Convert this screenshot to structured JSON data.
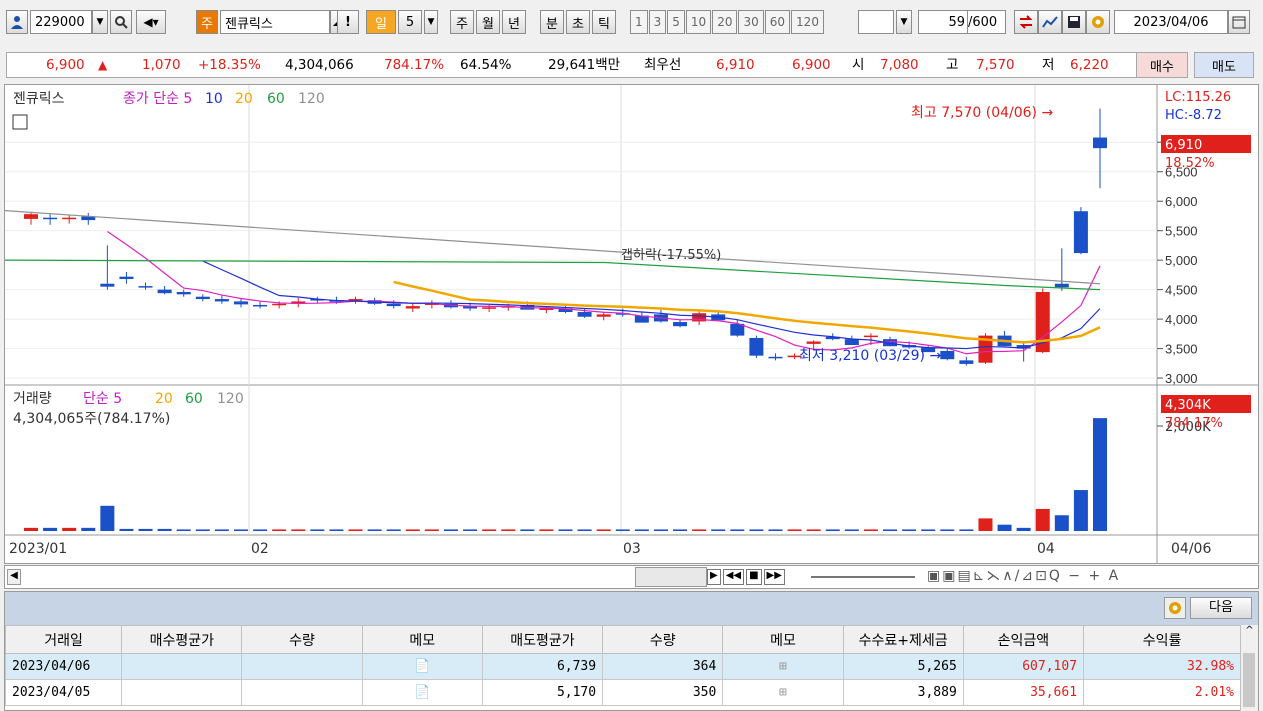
{
  "toolbar": {
    "code": "229000",
    "market": "주",
    "name": "젠큐릭스",
    "excl": "!",
    "period": "일",
    "num": "5",
    "btn_week": "주",
    "btn_month": "월",
    "btn_year": "년",
    "btn_minute": "분",
    "btn_second": "초",
    "btn_tick": "틱",
    "intervals": [
      "1",
      "3",
      "5",
      "10",
      "20",
      "30",
      "60",
      "120"
    ],
    "count": "59",
    "count_total": "/600",
    "date": "2023/04/06"
  },
  "price_bar": {
    "price": "6,900",
    "arrow": "▲",
    "change": "1,070",
    "pct": "+18.35%",
    "volume": "4,304,066",
    "vol_ratio": "784.17%",
    "turnover": "64.54%",
    "amount": "29,641백만",
    "best_label": "최우선",
    "best_sell": "6,910",
    "best_buy": "6,900",
    "open_label": "시",
    "open": "7,080",
    "high_label": "고",
    "high": "7,570",
    "low_label": "저",
    "low": "6,220",
    "buy_btn": "매수",
    "sell_btn": "매도"
  },
  "chart": {
    "legend": {
      "name": "젠큐릭스",
      "close_label": "종가 단순",
      "ma": [
        "5",
        "10",
        "20",
        "60",
        "120"
      ]
    },
    "vol_legend": {
      "name": "거래량",
      "simple": "단순",
      "ma": [
        "5",
        "20",
        "60",
        "120"
      ],
      "value": "4,304,065주(784.17%)"
    },
    "y_ticks": [
      "7,000",
      "6,500",
      "6,000",
      "5,500",
      "5,000",
      "4,500",
      "4,000",
      "3,500",
      "3,000"
    ],
    "vol_tick": "2,000K",
    "right_price": "6,910",
    "right_pct": "18.52%",
    "lc": "LC:115.26",
    "hc": "HC:-8.72",
    "vol_right": "4,304K",
    "vol_right_pct": "784.17%",
    "x_labels": [
      "2023/01",
      "02",
      "03",
      "04"
    ],
    "x_right": "04/06",
    "high_note": "최고 7,570 (04/06)",
    "low_note": "최저 3,210 (03/29)",
    "gap_note": "갭하락(-17.55%)",
    "colors": {
      "up": "#e0201b",
      "down": "#1a50c8",
      "ma5": "#e020c0",
      "ma10": "#2030d0",
      "ma20": "#f0a800",
      "ma60": "#20a040",
      "ma120": "#909090"
    }
  },
  "chart_data": {
    "type": "candlestick",
    "candles": [
      [
        5700,
        5820,
        5600,
        5780
      ],
      [
        5720,
        5780,
        5600,
        5700
      ],
      [
        5700,
        5760,
        5620,
        5720
      ],
      [
        5740,
        5800,
        5600,
        5680
      ],
      [
        4600,
        5250,
        4500,
        4550
      ],
      [
        4720,
        4800,
        4600,
        4680
      ],
      [
        4560,
        4620,
        4500,
        4540
      ],
      [
        4500,
        4560,
        4420,
        4440
      ],
      [
        4460,
        4500,
        4380,
        4420
      ],
      [
        4380,
        4420,
        4300,
        4340
      ],
      [
        4340,
        4400,
        4260,
        4300
      ],
      [
        4300,
        4350,
        4200,
        4250
      ],
      [
        4240,
        4300,
        4180,
        4220
      ],
      [
        4240,
        4300,
        4180,
        4260
      ],
      [
        4260,
        4360,
        4200,
        4300
      ],
      [
        4340,
        4380,
        4280,
        4320
      ],
      [
        4320,
        4380,
        4260,
        4300
      ],
      [
        4320,
        4380,
        4260,
        4340
      ],
      [
        4320,
        4360,
        4240,
        4260
      ],
      [
        4260,
        4320,
        4180,
        4220
      ],
      [
        4180,
        4280,
        4120,
        4220
      ],
      [
        4240,
        4320,
        4180,
        4280
      ],
      [
        4260,
        4320,
        4180,
        4200
      ],
      [
        4220,
        4280,
        4140,
        4180
      ],
      [
        4180,
        4240,
        4120,
        4200
      ],
      [
        4200,
        4260,
        4140,
        4220
      ],
      [
        4240,
        4300,
        4180,
        4160
      ],
      [
        4160,
        4220,
        4100,
        4180
      ],
      [
        4180,
        4220,
        4100,
        4120
      ],
      [
        4120,
        4180,
        4020,
        4040
      ],
      [
        4040,
        4120,
        3980,
        4080
      ],
      [
        4100,
        4180,
        4040,
        4080
      ],
      [
        4060,
        4120,
        3980,
        3940
      ],
      [
        4080,
        4160,
        3940,
        3960
      ],
      [
        3950,
        4000,
        3860,
        3880
      ],
      [
        3960,
        4160,
        3900,
        4100
      ],
      [
        4080,
        4140,
        4020,
        3980
      ],
      [
        3920,
        3980,
        3700,
        3720
      ],
      [
        3680,
        3720,
        3340,
        3380
      ],
      [
        3360,
        3420,
        3300,
        3340
      ],
      [
        3360,
        3420,
        3320,
        3380
      ],
      [
        3580,
        3640,
        3480,
        3620
      ],
      [
        3700,
        3760,
        3640,
        3660
      ],
      [
        3660,
        3720,
        3560,
        3560
      ],
      [
        3720,
        3760,
        3560,
        3720
      ],
      [
        3660,
        3700,
        3540,
        3540
      ],
      [
        3560,
        3620,
        3500,
        3520
      ],
      [
        3520,
        3560,
        3460,
        3440
      ],
      [
        3460,
        3500,
        3300,
        3320
      ],
      [
        3300,
        3360,
        3210,
        3240
      ],
      [
        3260,
        3760,
        3240,
        3720
      ],
      [
        3720,
        3800,
        3540,
        3540
      ],
      [
        3560,
        3620,
        3280,
        3500
      ],
      [
        3440,
        4520,
        3420,
        4460
      ],
      [
        4600,
        5200,
        4480,
        4540
      ],
      [
        5830,
        5900,
        5100,
        5120
      ],
      [
        7080,
        7570,
        6220,
        6900
      ]
    ],
    "volumes": [
      60,
      60,
      60,
      60,
      480,
      40,
      40,
      40,
      30,
      30,
      30,
      30,
      30,
      30,
      30,
      30,
      30,
      30,
      30,
      30,
      30,
      30,
      30,
      30,
      30,
      30,
      30,
      30,
      30,
      30,
      30,
      30,
      30,
      30,
      30,
      30,
      30,
      30,
      30,
      30,
      30,
      30,
      30,
      30,
      30,
      30,
      30,
      30,
      30,
      30,
      240,
      120,
      60,
      420,
      300,
      780,
      2150
    ],
    "ylim": [
      3000,
      7570
    ],
    "xlabel": "",
    "ylabel": ""
  },
  "controls": {
    "next": "다음"
  },
  "grid": {
    "headers": [
      "거래일",
      "매수평균가",
      "수량",
      "메모",
      "매도평균가",
      "수량",
      "메모",
      "수수료+제세금",
      "손익금액",
      "수익률"
    ],
    "rows": [
      [
        "2023/04/06",
        "",
        "",
        "",
        "6,739",
        "364",
        "",
        "5,265",
        "607,107",
        "32.98%"
      ],
      [
        "2023/04/05",
        "",
        "",
        "",
        "5,170",
        "350",
        "",
        "3,889",
        "35,661",
        "2.01%"
      ]
    ]
  }
}
